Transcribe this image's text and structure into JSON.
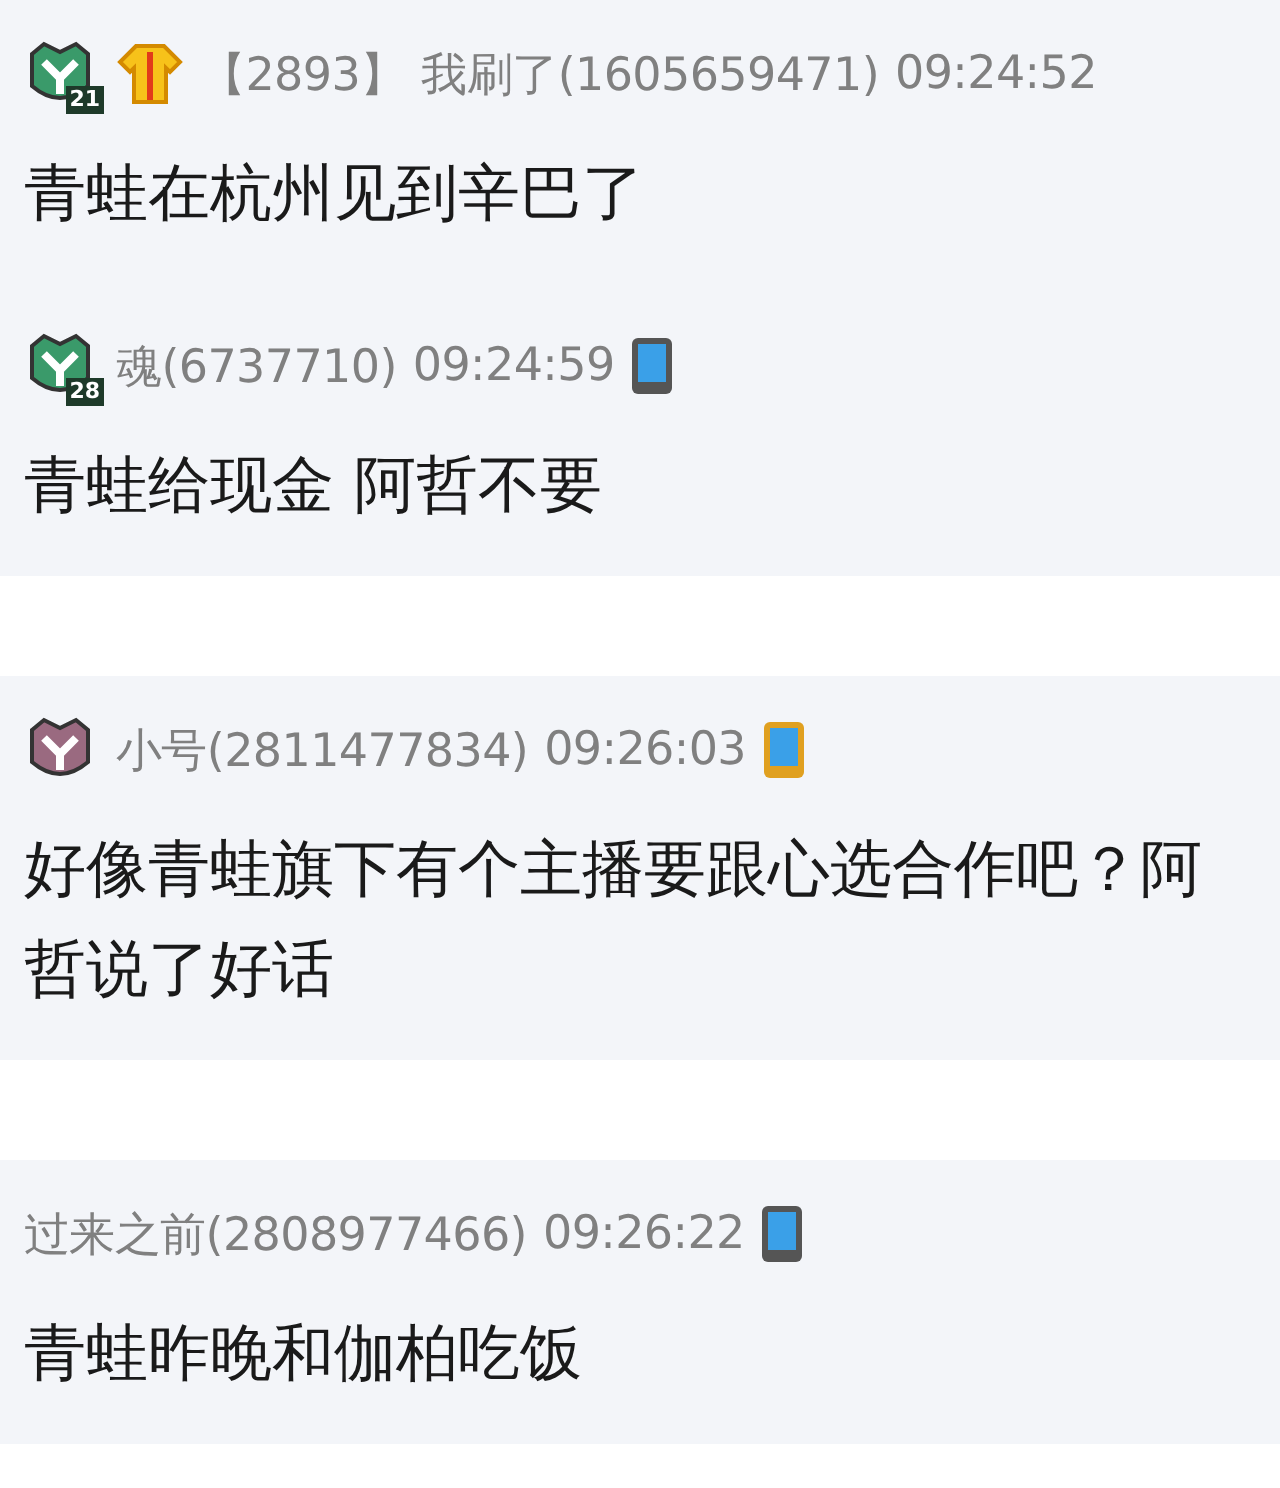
{
  "panels": [
    {
      "messages": [
        {
          "icons": [
            {
              "kind": "level-badge",
              "color": "#3a9a6a",
              "text": "21"
            },
            {
              "kind": "shirt"
            }
          ],
          "tag": "【2893】",
          "sender": "我刷了(1605659471)",
          "time": "09:24:52",
          "text": "青蛙在杭州见到辛巴了"
        },
        {
          "icons": [
            {
              "kind": "level-badge",
              "color": "#3a9a6a",
              "text": "28"
            }
          ],
          "sender": "魂(6737710)",
          "time": "09:24:59",
          "device": {
            "kind": "phone"
          },
          "text": "青蛙给现金 阿哲不要"
        }
      ]
    },
    {
      "messages": [
        {
          "icons": [
            {
              "kind": "level-badge",
              "color": "#9a6a80"
            }
          ],
          "sender": "小号(2811477834)",
          "time": "09:26:03",
          "device": {
            "kind": "phone-gold"
          },
          "text": "好像青蛙旗下有个主播要跟心选合作吧？阿哲说了好话"
        }
      ]
    },
    {
      "messages": [
        {
          "sender": "过来之前(2808977466)",
          "time": "09:26:22",
          "device": {
            "kind": "phone"
          },
          "text": "青蛙昨晚和伽柏吃饭"
        }
      ]
    }
  ]
}
